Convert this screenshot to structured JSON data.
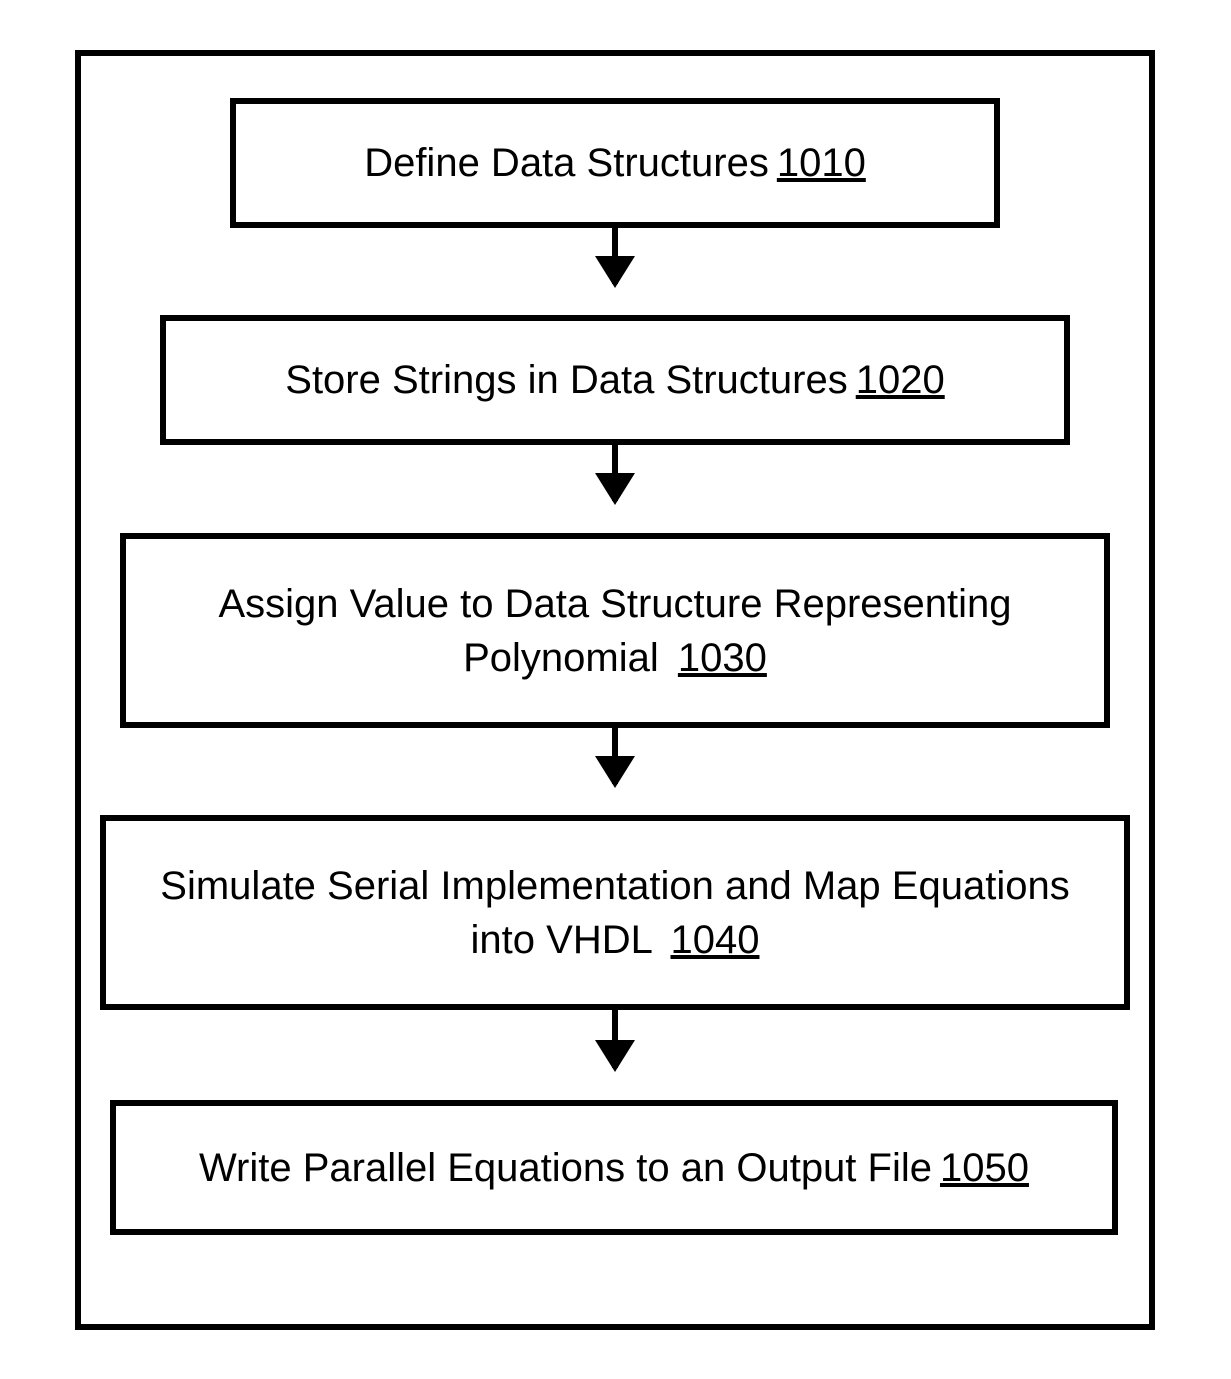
{
  "flowchart": {
    "nodes": [
      {
        "label": "Define Data Structures",
        "ref": "1010"
      },
      {
        "label": "Store Strings in Data Structures",
        "ref": "1020"
      },
      {
        "label": "Assign Value to Data Structure Representing Polynomial",
        "ref": "1030"
      },
      {
        "label": "Simulate Serial Implementation and Map Equations into VHDL",
        "ref": "1040"
      },
      {
        "label": "Write Parallel Equations to an Output File",
        "ref": "1050"
      }
    ]
  }
}
